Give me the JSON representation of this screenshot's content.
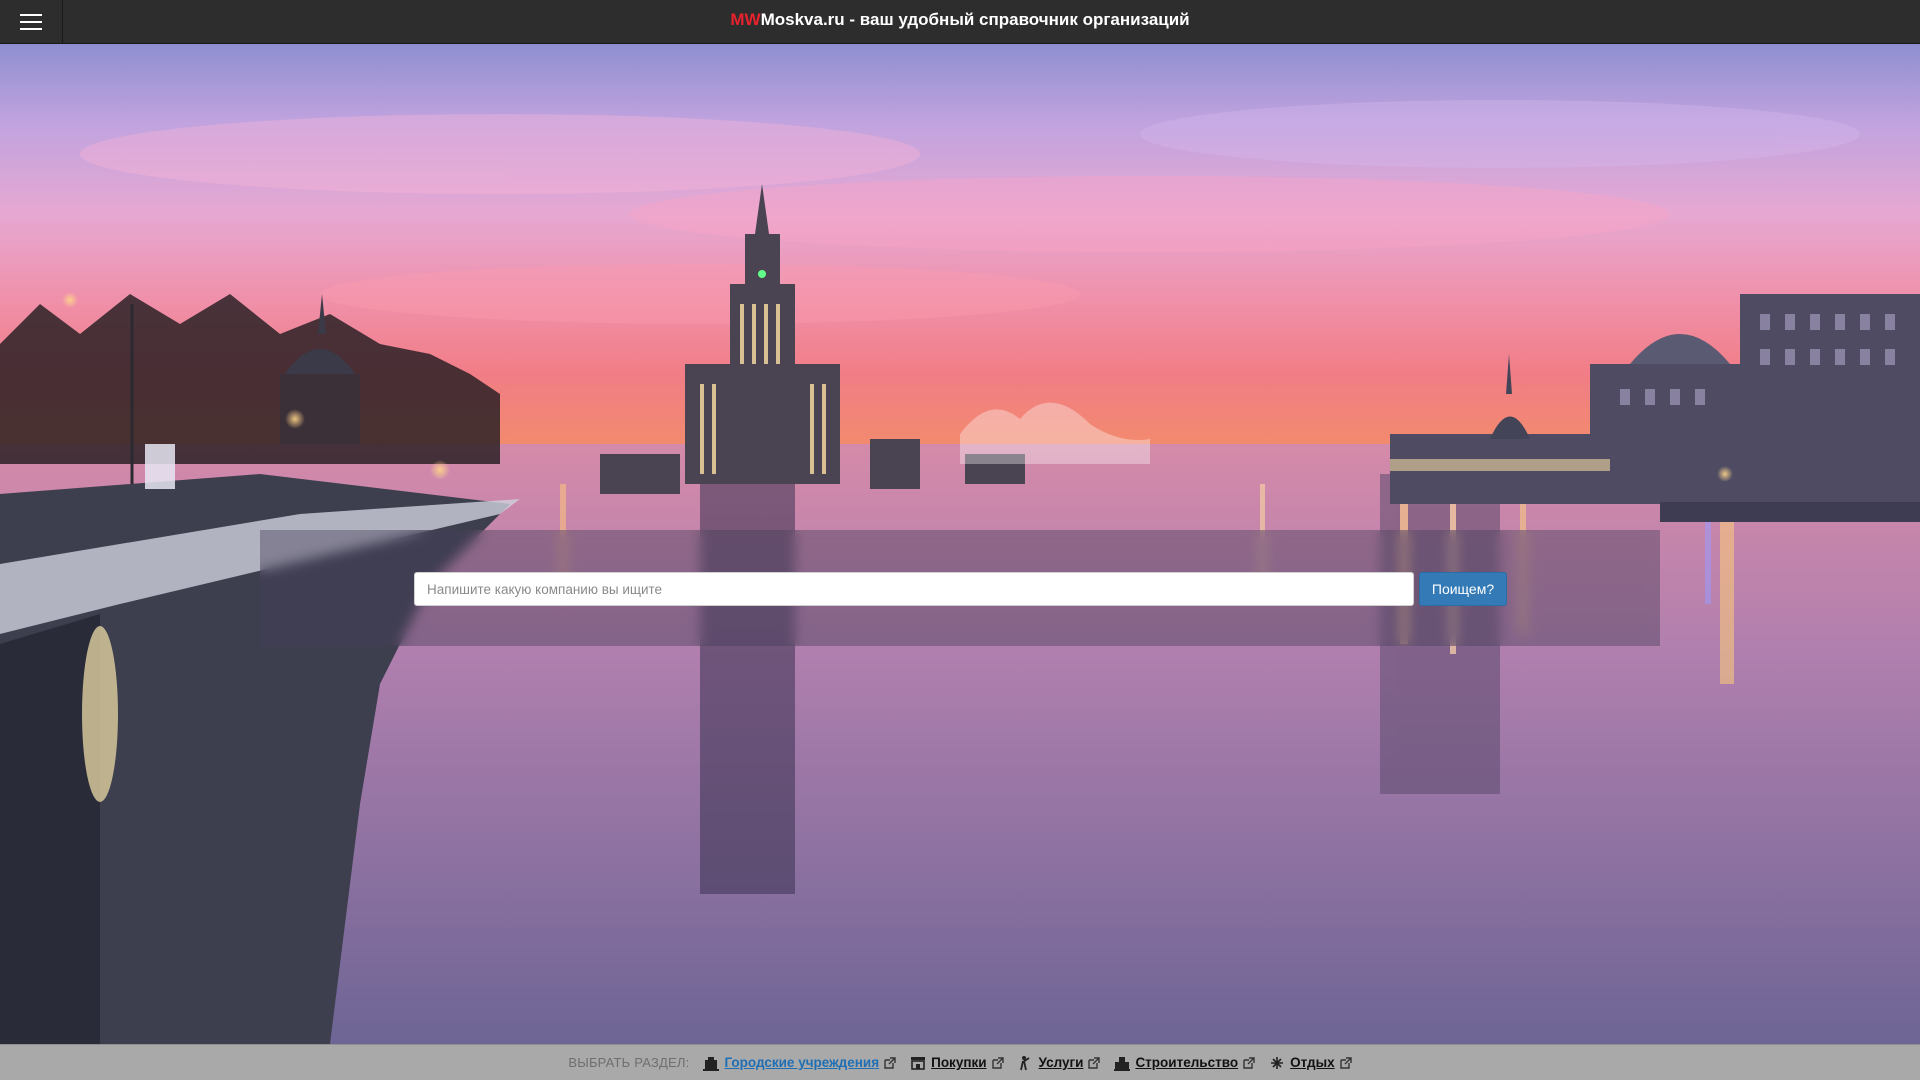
{
  "header": {
    "brand_accent": "MW",
    "brand_rest": "Moskva.ru - ваш удобный справочник организаций",
    "menu_icon": "hamburger-icon",
    "accent_color": "#e8222e"
  },
  "search": {
    "placeholder": "Напишите какую компанию вы ищите",
    "value": "",
    "button_label": "Поищем?",
    "button_color": "#337ab7"
  },
  "categories": {
    "label": "ВЫБРАТЬ РАЗДЕЛ:",
    "items": [
      {
        "label": "Городские учреждения",
        "icon": "institution-icon",
        "active": true
      },
      {
        "label": "Покупки",
        "icon": "shop-icon",
        "active": false
      },
      {
        "label": "Услуги",
        "icon": "service-person-icon",
        "active": false
      },
      {
        "label": "Строительство",
        "icon": "construction-icon",
        "active": false
      },
      {
        "label": "Отдых",
        "icon": "leisure-icon",
        "active": false
      }
    ],
    "external_icon": "external-link-icon",
    "active_color": "#1f6fb5"
  }
}
